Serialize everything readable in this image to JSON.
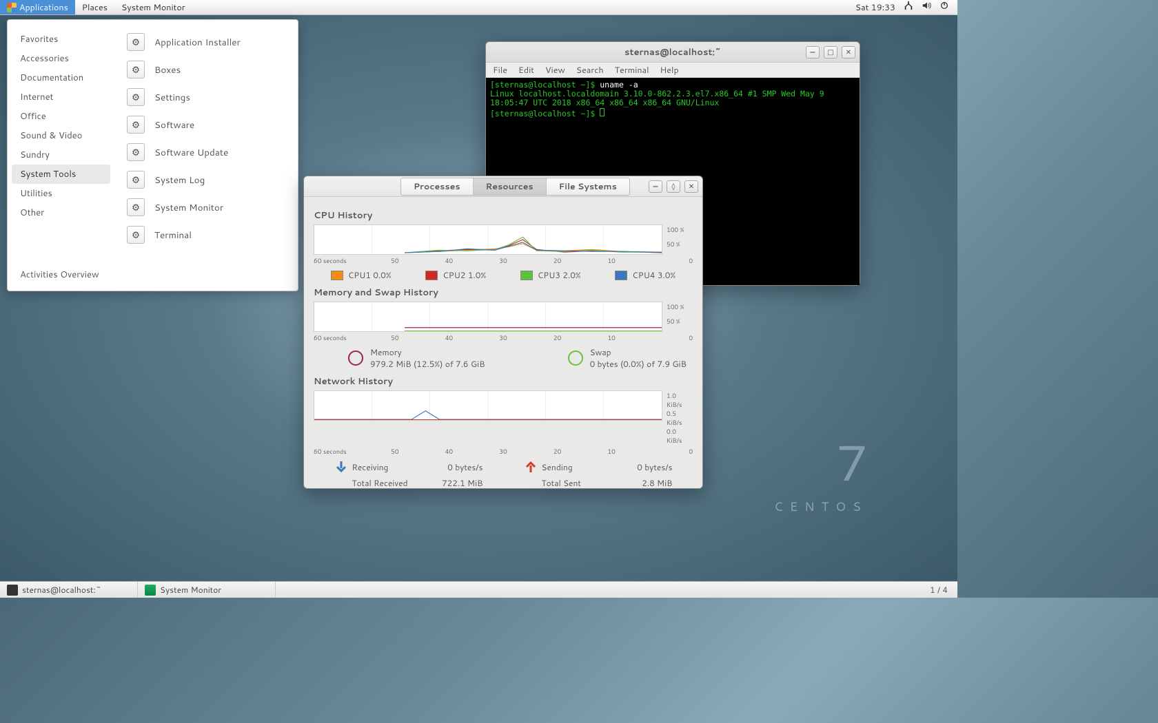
{
  "topbar": {
    "applications": "Applications",
    "places": "Places",
    "current_app": "System Monitor",
    "clock": "Sat 19:33"
  },
  "apps_menu": {
    "categories": [
      "Favorites",
      "Accessories",
      "Documentation",
      "Internet",
      "Office",
      "Sound & Video",
      "Sundry",
      "System Tools",
      "Utilities",
      "Other"
    ],
    "selected_category_index": 7,
    "activities": "Activities Overview",
    "items": [
      "Application Installer",
      "Boxes",
      "Settings",
      "Software",
      "Software Update",
      "System Log",
      "System Monitor",
      "Terminal"
    ]
  },
  "terminal": {
    "title": "sternas@localhost:~",
    "menus": [
      "File",
      "Edit",
      "View",
      "Search",
      "Terminal",
      "Help"
    ],
    "prompt1": "[sternas@localhost ~]$ ",
    "cmd": "uname -a",
    "output": "Linux localhost.localdomain 3.10.0-862.2.3.el7.x86_64 #1 SMP Wed May 9 18:05:47 UTC 2018 x86_64 x86_64 x86_64 GNU/Linux",
    "prompt2": "[sternas@localhost ~]$ "
  },
  "sysmon": {
    "tabs": [
      "Processes",
      "Resources",
      "File Systems"
    ],
    "active_tab_index": 1,
    "cpu": {
      "title": "CPU History",
      "xticks": [
        "60 seconds",
        "50",
        "40",
        "30",
        "20",
        "10",
        "0"
      ],
      "yticks": [
        "100 %",
        "50 %"
      ],
      "legend": [
        {
          "label": "CPU1",
          "value": "0.0%",
          "color": "#f08c1a"
        },
        {
          "label": "CPU2",
          "value": "1.0%",
          "color": "#cc2a2a"
        },
        {
          "label": "CPU3",
          "value": "2.0%",
          "color": "#5fbf3f"
        },
        {
          "label": "CPU4",
          "value": "3.0%",
          "color": "#3c78c0"
        }
      ]
    },
    "mem": {
      "title": "Memory and Swap History",
      "xticks": [
        "60 seconds",
        "50",
        "40",
        "30",
        "20",
        "10",
        "0"
      ],
      "yticks": [
        "100 %",
        "50 %"
      ],
      "memory_label": "Memory",
      "memory_detail": "979.2 MiB (12.5%) of 7.6 GiB",
      "swap_label": "Swap",
      "swap_detail": "0 bytes (0.0%) of 7.9 GiB"
    },
    "net": {
      "title": "Network History",
      "xticks": [
        "60 seconds",
        "50",
        "40",
        "30",
        "20",
        "10",
        "0"
      ],
      "yticks": [
        "1.0 KiB/s",
        "0.5 KiB/s",
        "0.0 KiB/s"
      ],
      "recv_label": "Receiving",
      "recv_rate": "0 bytes/s",
      "recv_total_label": "Total Received",
      "recv_total": "722.1 MiB",
      "send_label": "Sending",
      "send_rate": "0 bytes/s",
      "send_total_label": "Total Sent",
      "send_total": "2.8 MiB"
    }
  },
  "brand": {
    "seven": "7",
    "name": "CENTOS"
  },
  "taskbar": {
    "items": [
      "sternas@localhost:~",
      "System Monitor"
    ],
    "workspace": "1 / 4"
  },
  "chart_data": [
    {
      "type": "line",
      "title": "CPU History",
      "xlabel": "seconds",
      "ylabel": "%",
      "ylim": [
        0,
        100
      ],
      "x": [
        60,
        55,
        50,
        45,
        40,
        35,
        30,
        25,
        20,
        15,
        10,
        5,
        0
      ],
      "series": [
        {
          "name": "CPU1",
          "color": "#f08c1a",
          "values": [
            0,
            0,
            2,
            5,
            3,
            5,
            8,
            12,
            5,
            3,
            6,
            2,
            0
          ]
        },
        {
          "name": "CPU2",
          "color": "#cc2a2a",
          "values": [
            0,
            0,
            3,
            4,
            6,
            4,
            10,
            20,
            6,
            2,
            4,
            3,
            1
          ]
        },
        {
          "name": "CPU3",
          "color": "#5fbf3f",
          "values": [
            0,
            0,
            4,
            3,
            5,
            6,
            12,
            25,
            4,
            3,
            5,
            2,
            2
          ]
        },
        {
          "name": "CPU4",
          "color": "#3c78c0",
          "values": [
            0,
            0,
            2,
            6,
            4,
            5,
            9,
            15,
            5,
            4,
            3,
            3,
            3
          ]
        }
      ]
    },
    {
      "type": "line",
      "title": "Memory and Swap History",
      "xlabel": "seconds",
      "ylabel": "%",
      "ylim": [
        0,
        100
      ],
      "x": [
        60,
        50,
        40,
        30,
        20,
        10,
        0
      ],
      "series": [
        {
          "name": "Memory",
          "color": "#9b2358",
          "values": [
            12.5,
            12.5,
            12.5,
            12.5,
            12.5,
            12.5,
            12.5
          ]
        },
        {
          "name": "Swap",
          "color": "#6fbf3f",
          "values": [
            0,
            0,
            0,
            0,
            0,
            0,
            0
          ]
        }
      ]
    },
    {
      "type": "line",
      "title": "Network History",
      "xlabel": "seconds",
      "ylabel": "KiB/s",
      "ylim": [
        0,
        1.0
      ],
      "x": [
        60,
        50,
        40,
        30,
        20,
        10,
        0
      ],
      "series": [
        {
          "name": "Receiving",
          "color": "#3c78c0",
          "values": [
            0,
            0,
            0.3,
            0,
            0,
            0,
            0
          ]
        },
        {
          "name": "Sending",
          "color": "#d04028",
          "values": [
            0,
            0,
            0,
            0,
            0,
            0,
            0
          ]
        }
      ]
    }
  ]
}
